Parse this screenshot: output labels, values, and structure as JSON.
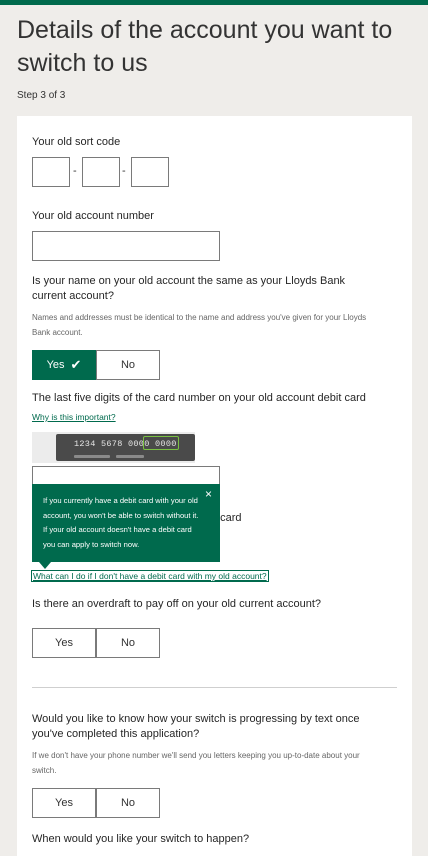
{
  "page": {
    "title": "Details of the account you want to switch to us",
    "step": "Step 3 of 3"
  },
  "sort_code": {
    "label": "Your old sort code",
    "separator": "-"
  },
  "account_number": {
    "label": "Your old account number"
  },
  "same_name": {
    "question": "Is your name on your old account the same as your Lloyds Bank current account?",
    "hint": "Names and addresses must be identical to the name and address you've given for your Lloyds Bank account.",
    "yes": "Yes",
    "no": "No",
    "selected": "Yes"
  },
  "debit_card": {
    "label": "The last five digits of the card number on your old account debit card",
    "why_link": "Why is this important?",
    "card_number": "1234 5678 0000 0000",
    "hidden_label_fragment": "t card",
    "tooltip_text": "If you currently have a debit card with your old account, you won't be able to switch without it. If your old account doesn't have a debit card you can apply to switch now.",
    "tooltip_close": "×",
    "no_card_link": "What can I do if I don't have a debit card with my old account?"
  },
  "overdraft": {
    "question": "Is there an overdraft to pay off on your old current account?",
    "yes": "Yes",
    "no": "No"
  },
  "text_updates": {
    "question": "Would you like to know how your switch is progressing by text once you've completed this application?",
    "hint": "If we don't have your phone number we'll send you letters keeping you up-to-date about your switch.",
    "yes": "Yes",
    "no": "No"
  },
  "switch_date": {
    "question": "When would you like your switch to happen?"
  },
  "colors": {
    "brand_green": "#006a4d",
    "highlight_green": "#7ac142",
    "background": "#efedea"
  },
  "icons": {
    "check": "check-icon",
    "close": "close-icon"
  }
}
